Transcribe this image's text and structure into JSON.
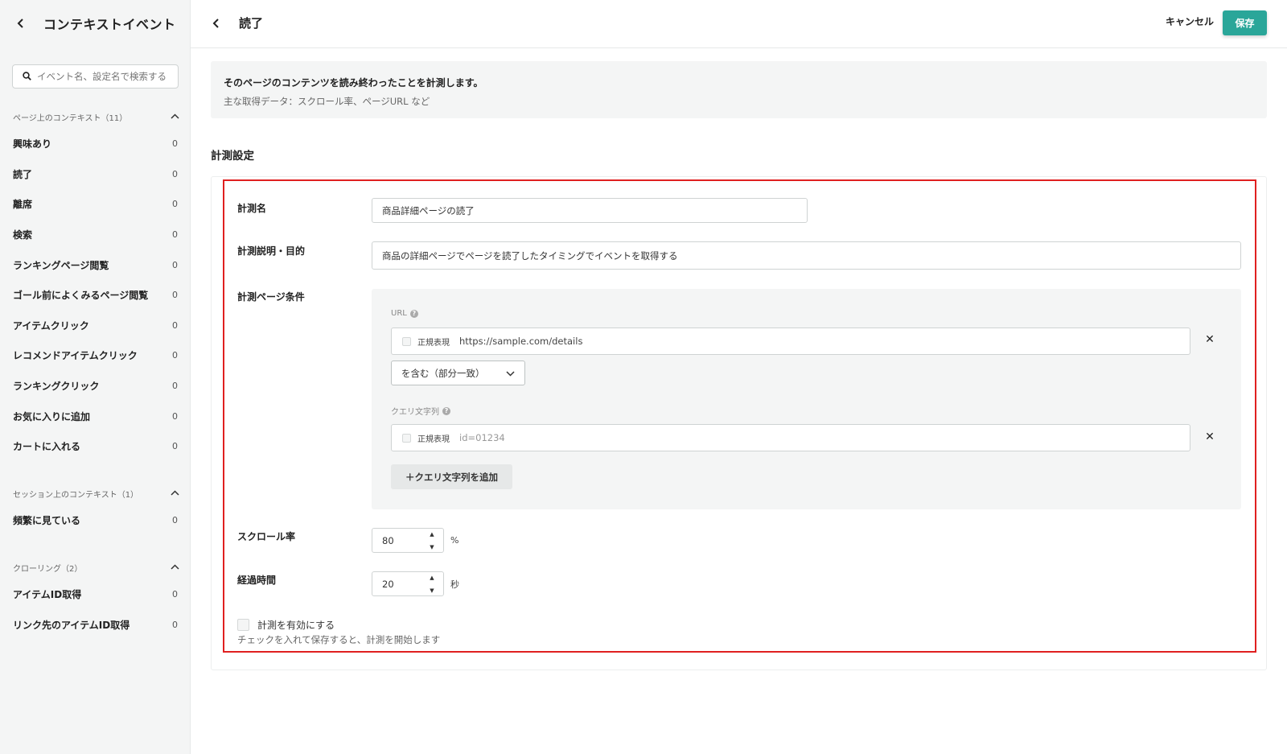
{
  "sidebar": {
    "title": "コンテキストイベント",
    "search_placeholder": "イベント名、設定名で検索する",
    "sections": [
      {
        "header": "ページ上のコンテキスト（11）",
        "items": [
          {
            "label": "興味あり",
            "count": "0"
          },
          {
            "label": "読了",
            "count": "0"
          },
          {
            "label": "離席",
            "count": "0"
          },
          {
            "label": "検索",
            "count": "0"
          },
          {
            "label": "ランキングページ閲覧",
            "count": "0"
          },
          {
            "label": "ゴール前によくみるページ閲覧",
            "count": "0"
          },
          {
            "label": "アイテムクリック",
            "count": "0"
          },
          {
            "label": "レコメンドアイテムクリック",
            "count": "0"
          },
          {
            "label": "ランキングクリック",
            "count": "0"
          },
          {
            "label": "お気に入りに追加",
            "count": "0"
          },
          {
            "label": "カートに入れる",
            "count": "0"
          }
        ]
      },
      {
        "header": "セッション上のコンテキスト（1）",
        "items": [
          {
            "label": "頻繁に見ている",
            "count": "0"
          }
        ]
      },
      {
        "header": "クローリング（2）",
        "items": [
          {
            "label": "アイテムID取得",
            "count": "0"
          },
          {
            "label": "リンク先のアイテムID取得",
            "count": "0"
          }
        ]
      }
    ]
  },
  "topbar": {
    "title": "読了",
    "cancel_label": "キャンセル",
    "save_label": "保存"
  },
  "info": {
    "title": "そのページのコンテンツを読み終わったことを計測します。",
    "subtitle": "主な取得データ：スクロール率、ページURL など"
  },
  "form": {
    "section_title": "計測設定",
    "name_label": "計測名",
    "name_value": "商品詳細ページの読了",
    "desc_label": "計測説明・目的",
    "desc_value": "商品の詳細ページでページを読了したタイミングでイベントを取得する",
    "page_cond_label": "計測ページ条件",
    "url_label": "URL",
    "regex_label": "正規表現",
    "url_value": "https://sample.com/details",
    "match_select": "を含む（部分一致）",
    "query_label": "クエリ文字列",
    "query_placeholder": "id=01234",
    "add_query_label": "＋クエリ文字列を追加",
    "scroll_label": "スクロール率",
    "scroll_value": "80",
    "scroll_unit": "%",
    "time_label": "経過時間",
    "time_value": "20",
    "time_unit": "秒",
    "enable_label": "計測を有効にする",
    "enable_help": "チェックを入れて保存すると、計測を開始します"
  },
  "colors": {
    "accent": "#2aa699",
    "highlight": "#e02020",
    "sidebar_bg": "#f4f5f5"
  }
}
